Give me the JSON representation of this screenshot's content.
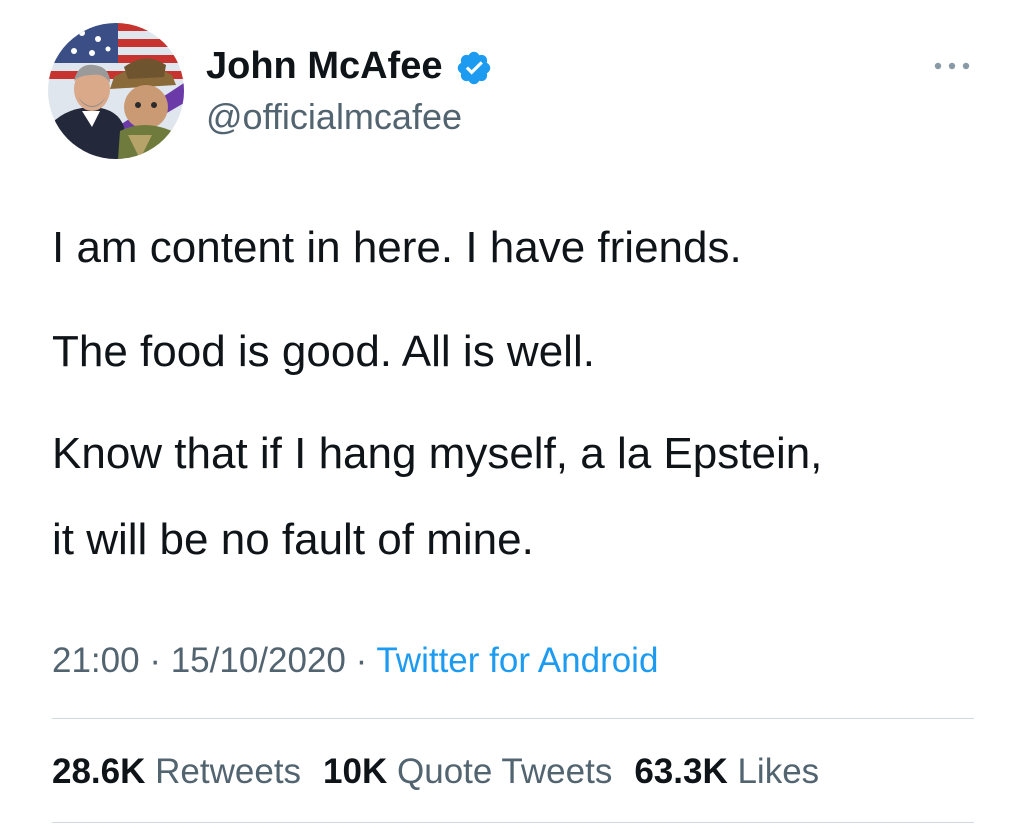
{
  "author": {
    "display_name": "John McAfee",
    "handle": "@officialmcafee",
    "verified_icon": "verified-badge-icon",
    "avatar_icon": "profile-avatar"
  },
  "more_icon": "more-options-icon",
  "tweet": {
    "paragraphs": [
      "I am content in here. I have friends.",
      "The food is good. All is well.",
      "Know that if I hang myself, a la Epstein,",
      "it will be no fault of mine."
    ]
  },
  "meta": {
    "time": "21:00",
    "separator_1": " · ",
    "date": "15/10/2020",
    "separator_2": " · ",
    "source": "Twitter for Android"
  },
  "stats": [
    {
      "count": "28.6K",
      "label": "Retweets"
    },
    {
      "count": "10K",
      "label": "Quote Tweets"
    },
    {
      "count": "63.3K",
      "label": "Likes"
    }
  ],
  "colors": {
    "text_primary": "#0f1419",
    "text_secondary": "#536471",
    "link_blue": "#1d9bf0",
    "divider": "#cfd9de"
  }
}
